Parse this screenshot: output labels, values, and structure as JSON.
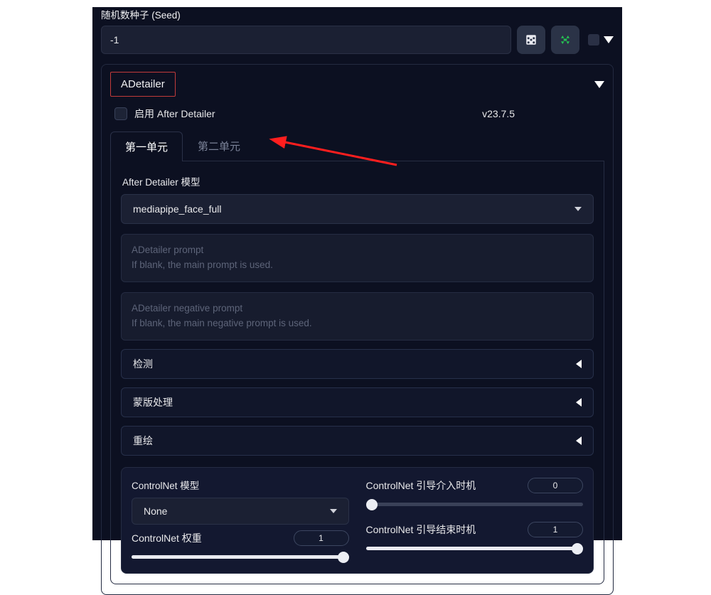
{
  "seed": {
    "label": "随机数种子 (Seed)",
    "value": "-1"
  },
  "adetailer": {
    "title": "ADetailer",
    "enable_label": "启用 After Detailer",
    "version": "v23.7.5",
    "tabs": {
      "t1": "第一单元",
      "t2": "第二单元"
    },
    "model_label": "After Detailer 模型",
    "model_value": "mediapipe_face_full",
    "prompt_ph_line1": "ADetailer prompt",
    "prompt_ph_line2": "If blank, the main prompt is used.",
    "neg_ph_line1": "ADetailer negative prompt",
    "neg_ph_line2": "If blank, the main negative prompt is used.",
    "acc_detect": "检测",
    "acc_mask": "蒙版处理",
    "acc_inpaint": "重绘"
  },
  "controlnet": {
    "model_label": "ControlNet 模型",
    "model_value": "None",
    "weight_label": "ControlNet 权重",
    "weight_value": "1",
    "start_label": "ControlNet 引导介入时机",
    "start_value": "0",
    "end_label": "ControlNet 引导结束时机",
    "end_value": "1"
  }
}
